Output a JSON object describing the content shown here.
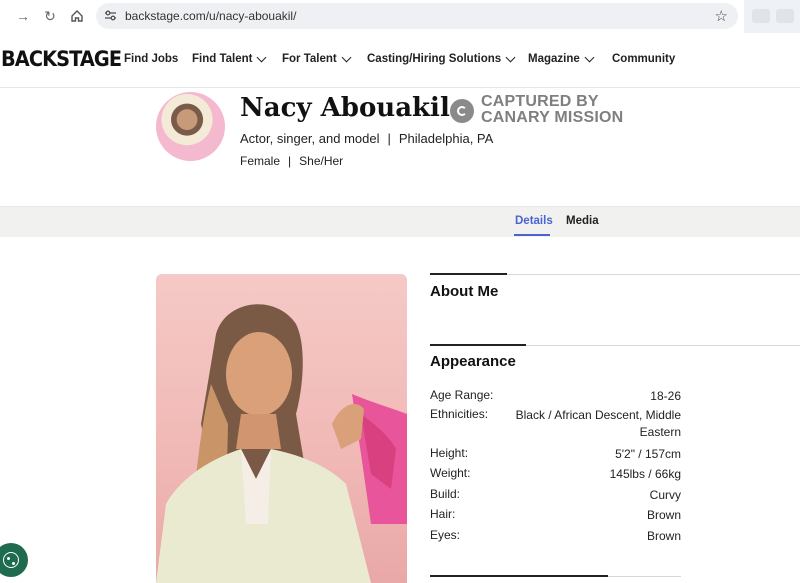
{
  "browser": {
    "url": "backstage.com/u/nacy-abouakil/"
  },
  "site": {
    "logo": "BACKSTAGE",
    "nav": [
      {
        "label": "Find Jobs",
        "dropdown": false
      },
      {
        "label": "Find Talent",
        "dropdown": true
      },
      {
        "label": "For Talent",
        "dropdown": true
      },
      {
        "label": "Casting/Hiring Solutions",
        "dropdown": true
      },
      {
        "label": "Magazine",
        "dropdown": true
      },
      {
        "label": "Community",
        "dropdown": false
      }
    ]
  },
  "profile": {
    "name": "Nacy Abouakil",
    "badge_line1": "CAPTURED BY",
    "badge_line2": "CANARY MISSION",
    "occupation": "Actor, singer, and model",
    "location": "Philadelphia, PA",
    "gender": "Female",
    "pronouns": "She/Her",
    "separator": "|"
  },
  "tabs": [
    {
      "label": "Details",
      "active": true
    },
    {
      "label": "Media",
      "active": false
    }
  ],
  "about": {
    "title": "About Me"
  },
  "appearance": {
    "title": "Appearance",
    "rows": [
      {
        "label": "Age Range:",
        "value": "18-26"
      },
      {
        "label": "Ethnicities:",
        "value": "Black / African Descent, Middle Eastern"
      },
      {
        "label": "Height:",
        "value": "5'2\" / 157cm"
      },
      {
        "label": "Weight:",
        "value": "145lbs / 66kg"
      },
      {
        "label": "Build:",
        "value": "Curvy"
      },
      {
        "label": "Hair:",
        "value": "Brown"
      },
      {
        "label": "Eyes:",
        "value": "Brown"
      }
    ]
  },
  "colors": {
    "accent": "#4a63d1",
    "tab_bar": "#f1f1ef",
    "cookie": "#1f6b4f"
  }
}
